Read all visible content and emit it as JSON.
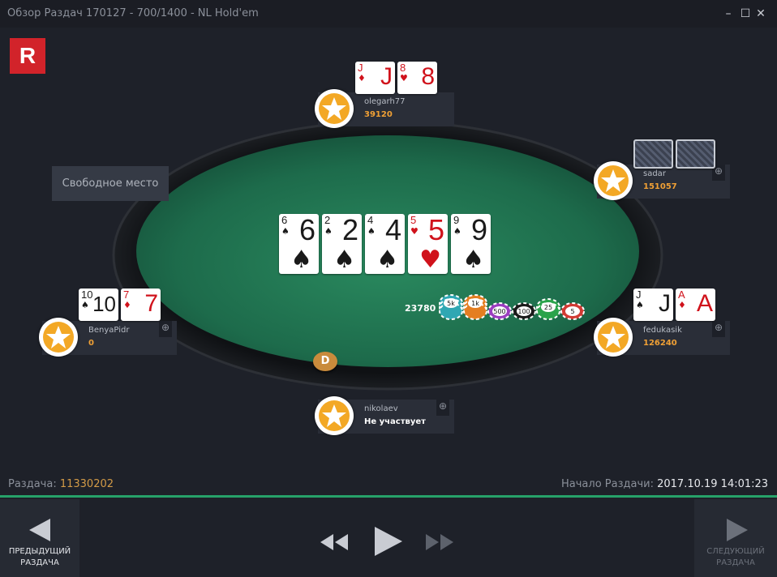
{
  "window": {
    "title": "Обзор Раздач 170127 - 700/1400 - NL Hold'em",
    "controls": {
      "minimize": "–",
      "maximize": "☐",
      "close": "✕"
    }
  },
  "logo": {
    "letter": "R",
    "color": "#d2232a"
  },
  "board": {
    "cards": [
      {
        "rank": "6",
        "suit": "♠",
        "color": "black"
      },
      {
        "rank": "2",
        "suit": "♠",
        "color": "black"
      },
      {
        "rank": "4",
        "suit": "♠",
        "color": "black"
      },
      {
        "rank": "5",
        "suit": "♥",
        "color": "red"
      },
      {
        "rank": "9",
        "suit": "♠",
        "color": "black"
      }
    ]
  },
  "free_seat": {
    "label": "Свободное место"
  },
  "players": {
    "olegarh77": {
      "name": "olegarh77",
      "stack": "39120",
      "cards": [
        {
          "rank": "J",
          "suit": "♦"
        },
        {
          "rank": "8",
          "suit": "♥"
        }
      ]
    },
    "sadar": {
      "name": "sadar",
      "stack": "151057"
    },
    "benyapidr": {
      "name": "BenyaPidr",
      "stack": "0",
      "cards": [
        {
          "rank": "10",
          "suit": "♠"
        },
        {
          "rank": "7",
          "suit": "♦"
        }
      ]
    },
    "fedukasik": {
      "name": "fedukasik",
      "stack": "126240",
      "cards": [
        {
          "rank": "J",
          "suit": "♠"
        },
        {
          "rank": "A",
          "suit": "♦"
        }
      ]
    },
    "nikolaev": {
      "name": "nikolaev",
      "status": "Не участвует"
    }
  },
  "pot": {
    "amount": "23780",
    "chips": [
      "5k",
      "1k",
      "500",
      "100",
      "25",
      "5"
    ]
  },
  "dealer_button": "D",
  "footer": {
    "hand_label": "Раздача:",
    "hand_number": "11330202",
    "start_label": "Начало Раздачи:",
    "start_time": "2017.10.19 14:01:23"
  },
  "nav": {
    "prev_line1": "ПРЕДЫДУЩИЙ",
    "prev_line2": "РАЗДАЧА",
    "next_line1": "СЛЕДУЮЩИЙ",
    "next_line2": "РАЗДАЧА"
  },
  "colors": {
    "felt": "#1f6e4e",
    "accent_stack": "#f0a035",
    "divider": "#26a269"
  }
}
